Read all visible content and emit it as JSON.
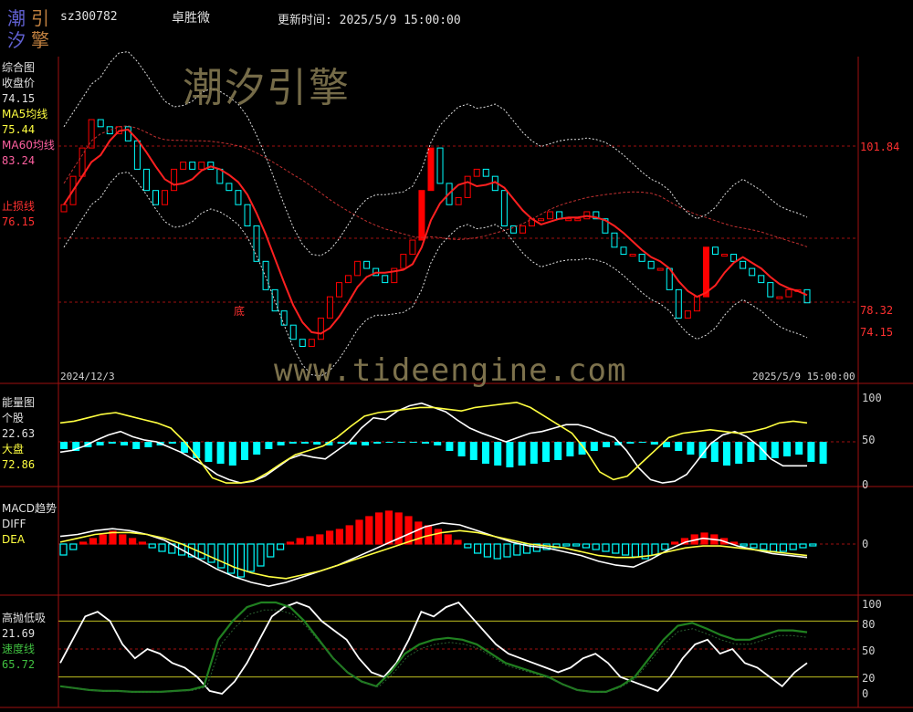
{
  "header": {
    "logo_chars": [
      "潮",
      "引",
      "汐",
      "擎"
    ],
    "code": "sz300782",
    "name": "卓胜微",
    "update_label": "更新时间: 2025/5/9 15:00:00"
  },
  "watermarks": {
    "cn": "潮汐引擎",
    "url": "www.tideengine.com"
  },
  "colors": {
    "up": "#ff0000",
    "down": "#00ffff",
    "ma5": "#ff2020",
    "ma60": "#c03030",
    "grid": "#a01010",
    "white": "#ffffff",
    "yellow": "#ffff40",
    "green": "#208020"
  },
  "panel1": {
    "title": "综合图",
    "close_label": "收盘价",
    "close_value": "74.15",
    "ma5_label": "MA5均线",
    "ma5_value": "75.44",
    "ma60_label": "MA60均线",
    "ma60_value": "83.24",
    "stop_label": "止损线",
    "stop_value": "76.15",
    "bottom_marker": "底",
    "date_start": "2024/12/3",
    "date_end": "2025/5/9 15:00:00",
    "right_ticks": [
      "101.84",
      "78.32",
      "74.15"
    ]
  },
  "panel2": {
    "title": "能量图",
    "stock_label": "个股",
    "stock_value": "22.63",
    "market_label": "大盘",
    "market_value": "72.86",
    "right_ticks": [
      "100",
      "50",
      "0"
    ]
  },
  "panel3": {
    "title": "MACD趋势",
    "diff_label": "DIFF",
    "dea_label": "DEA",
    "right_ticks": [
      "0"
    ]
  },
  "panel4": {
    "title": "高抛低吸",
    "value": "21.69",
    "speed_label": "速度线",
    "speed_value": "65.72",
    "right_ticks": [
      "100",
      "80",
      "50",
      "20",
      "0"
    ]
  },
  "chart_data": {
    "type": "candlestick",
    "price_axis_ticks": [
      101.84,
      78.32,
      74.15
    ],
    "closes": [
      88,
      92,
      96,
      100,
      99,
      98,
      99,
      97,
      93,
      90,
      88,
      90,
      93,
      94,
      93,
      94,
      93,
      91,
      90,
      88,
      85,
      80,
      76,
      73,
      71,
      69,
      68,
      69,
      72,
      75,
      77,
      78,
      80,
      79,
      78,
      77,
      79,
      81,
      83,
      90,
      96,
      91,
      88,
      89,
      92,
      93,
      92,
      90,
      85,
      84,
      85,
      86,
      86,
      87,
      86,
      86,
      86,
      87,
      86,
      84,
      82,
      81,
      81,
      80,
      79,
      79,
      76,
      72,
      73,
      75,
      82,
      81,
      81,
      80,
      79,
      78,
      77,
      75,
      75,
      76,
      76,
      74.15
    ],
    "energy_stock": [
      38,
      40,
      45,
      52,
      58,
      62,
      56,
      52,
      50,
      44,
      38,
      30,
      22,
      12,
      6,
      2,
      4,
      10,
      20,
      30,
      35,
      32,
      30,
      40,
      50,
      66,
      78,
      76,
      86,
      92,
      95,
      90,
      85,
      75,
      66,
      60,
      55,
      50,
      55,
      60,
      62,
      66,
      70,
      70,
      66,
      60,
      55,
      40,
      20,
      6,
      2,
      4,
      12,
      30,
      48,
      58,
      62,
      56,
      45,
      30,
      22,
      22,
      22
    ],
    "energy_market": [
      72,
      74,
      78,
      82,
      84,
      80,
      76,
      72,
      66,
      50,
      30,
      8,
      2,
      2,
      5,
      14,
      25,
      35,
      40,
      45,
      55,
      68,
      80,
      84,
      86,
      88,
      90,
      90,
      88,
      86,
      90,
      92,
      94,
      96,
      90,
      80,
      70,
      60,
      40,
      15,
      6,
      10,
      25,
      40,
      55,
      60,
      62,
      64,
      62,
      60,
      62,
      66,
      72,
      74,
      72
    ]
  }
}
